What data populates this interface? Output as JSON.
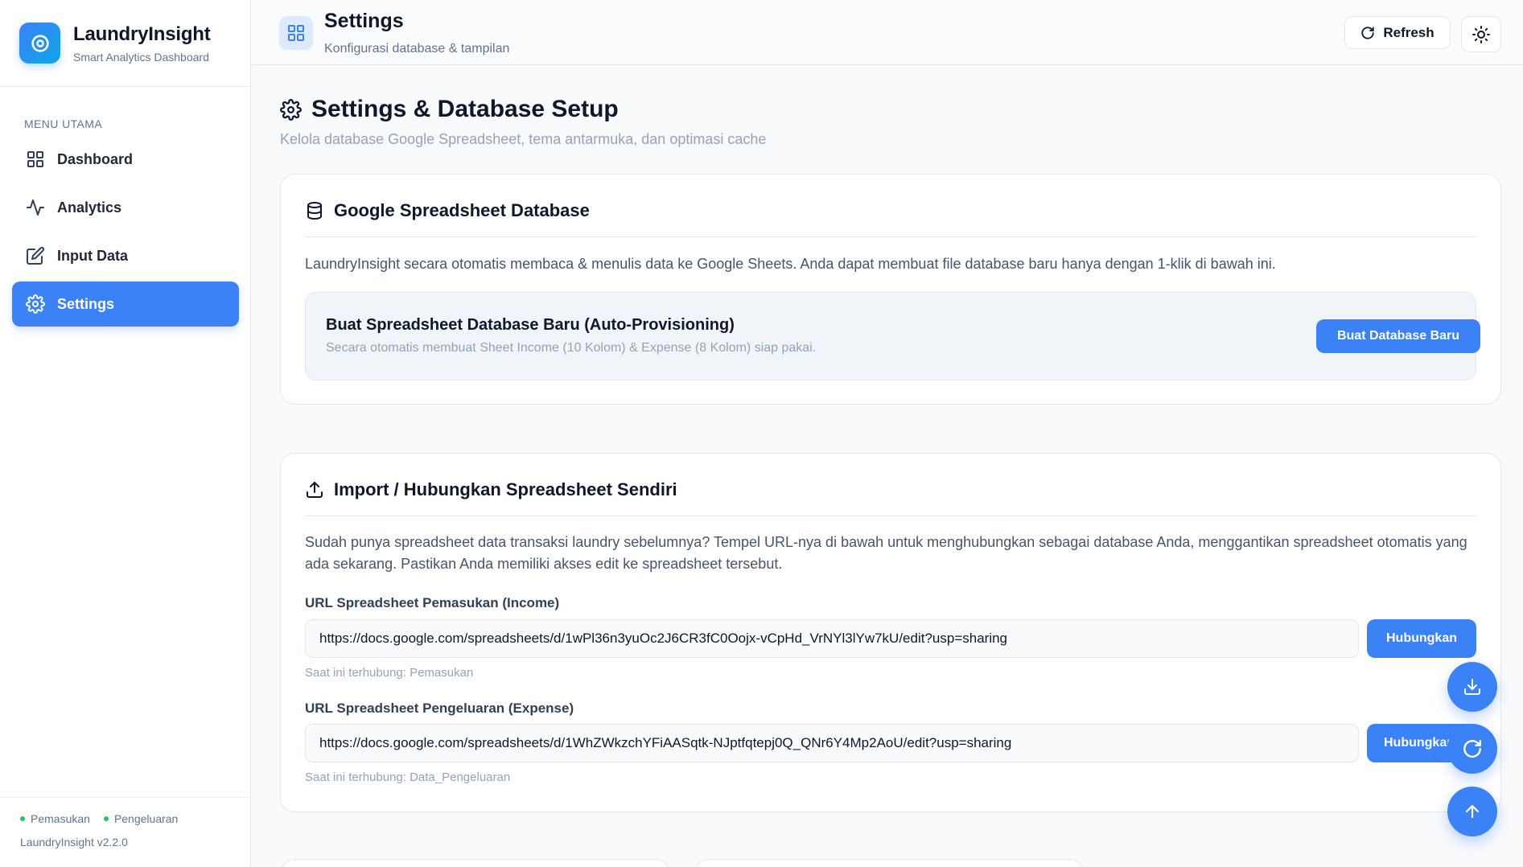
{
  "brand": {
    "name": "LaundryInsight",
    "subtitle": "Smart Analytics Dashboard"
  },
  "sidebar": {
    "section_title": "MENU UTAMA",
    "items": [
      {
        "label": "Dashboard",
        "icon": "grid-icon",
        "active": false
      },
      {
        "label": "Analytics",
        "icon": "activity-icon",
        "active": false
      },
      {
        "label": "Input Data",
        "icon": "edit-icon",
        "active": true
      },
      {
        "label": "Settings",
        "icon": "gear-icon",
        "active": true
      }
    ],
    "legend": [
      {
        "label": "Pemasukan",
        "color": "#22c55e"
      },
      {
        "label": "Pengeluaran",
        "color": "#22c55e"
      }
    ],
    "version": "LaundryInsight v2.2.0"
  },
  "header": {
    "title": "Settings",
    "subtitle": "Konfigurasi database & tampilan",
    "refresh_label": "Refresh"
  },
  "main": {
    "title": "Settings & Database Setup",
    "subtitle": "Kelola database Google Spreadsheet, tema antarmuka, dan optimasi cache",
    "db_card": {
      "title": "Google Spreadsheet Database",
      "description": "LaundryInsight secara otomatis membaca & menulis data ke Google Sheets. Anda dapat membuat file database baru hanya dengan 1-klik di bawah ini.",
      "provision_title": "Buat Spreadsheet Database Baru (Auto-Provisioning)",
      "provision_sub": "Secara otomatis membuat Sheet Income (10 Kolom) & Expense (8 Kolom) siap pakai.",
      "create_button": "Buat Database Baru"
    },
    "import_card": {
      "title": "Import / Hubungkan Spreadsheet Sendiri",
      "description": "Sudah punya spreadsheet data transaksi laundry sebelumnya? Tempel URL-nya di bawah untuk menghubungkan sebagai database Anda, menggantikan spreadsheet otomatis yang ada sekarang. Pastikan Anda memiliki akses edit ke spreadsheet tersebut.",
      "income": {
        "label": "URL Spreadsheet Pemasukan (Income)",
        "value": "https://docs.google.com/spreadsheets/d/1wPl36n3yuOc2J6CR3fC0Oojx-vCpHd_VrNYl3lYw7kU/edit?usp=sharing",
        "button": "Hubungkan",
        "note": "Saat ini terhubung: Pemasukan"
      },
      "expense": {
        "label": "URL Spreadsheet Pengeluaran (Expense)",
        "value": "https://docs.google.com/spreadsheets/d/1WhZWkzchYFiAASqtk-NJptfqtepj0Q_QNr6Y4Mp2AoU/edit?usp=sharing",
        "button": "Hubungkan",
        "note": "Saat ini terhubung: Data_Pengeluaran"
      }
    }
  },
  "colors": {
    "accent": "#3b82f6",
    "legend_dot": "#22c55e"
  }
}
